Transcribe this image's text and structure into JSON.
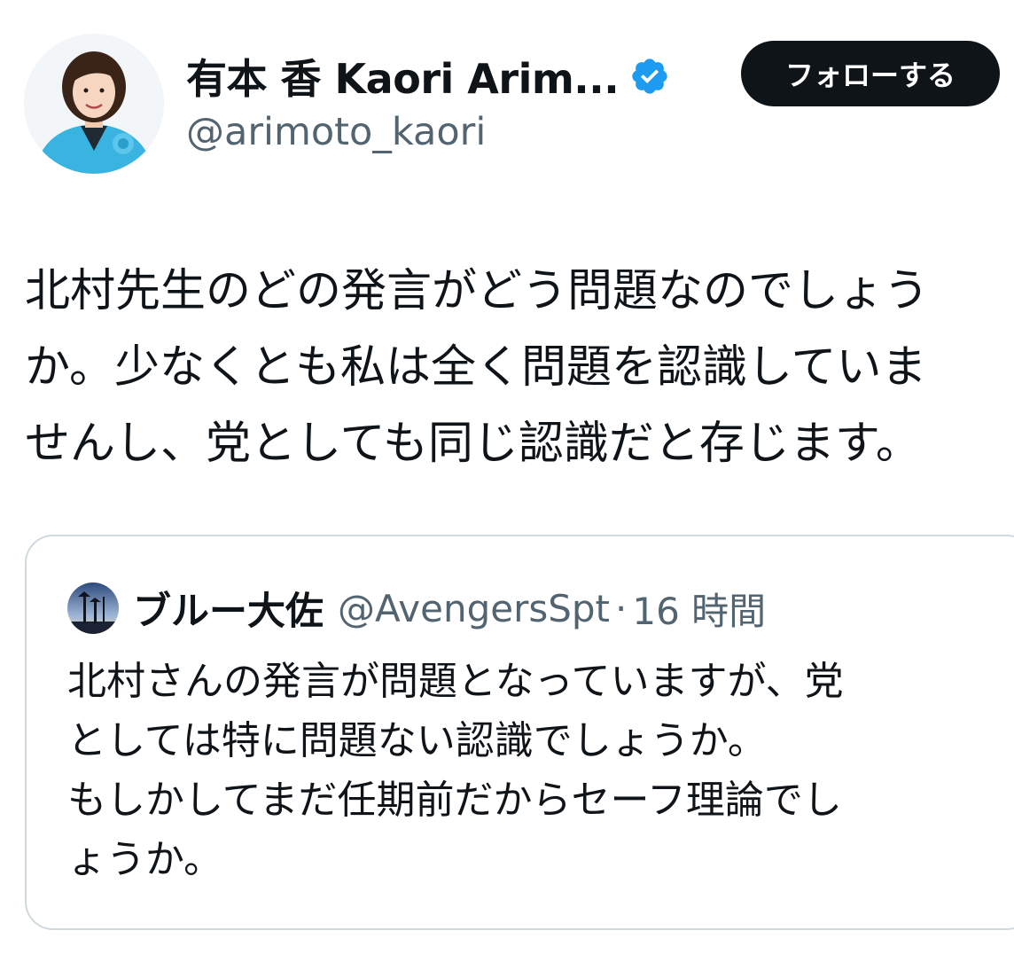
{
  "author": {
    "display_name": "有本 香 Kaori Arim...",
    "handle": "@arimoto_kaori",
    "verified": true,
    "avatar_icon": "profile-photo-woman-blue-jacket"
  },
  "follow_button": {
    "label": "フォローする"
  },
  "tweet": {
    "lines": [
      "北村先生のどの発言がどう問題なのでしょう",
      "か。少なくとも私は全く問題を認識していま",
      "せんし、党としても同じ認識だと存じます。"
    ]
  },
  "quoted_tweet": {
    "author_name": "ブルー大佐",
    "handle": "@AvengersSpt",
    "separator": "·",
    "time": "16 時間",
    "avatar_icon": "sunset-silhouette-avatar",
    "lines": [
      "北村さんの発言が問題となっていますが、党",
      "としては特に問題ない認識でしょうか。",
      "もしかしてまだ任期前だからセーフ理論でし",
      "ょうか。"
    ]
  },
  "colors": {
    "text_primary": "#0f1419",
    "text_secondary": "#536471",
    "verified_blue": "#1d9bf0",
    "button_bg": "#0f1419",
    "border": "#cfd9de"
  }
}
